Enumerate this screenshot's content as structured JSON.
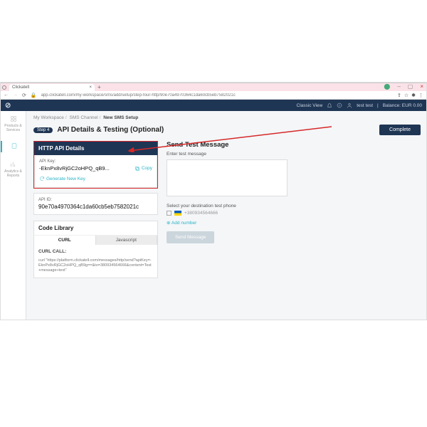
{
  "browser": {
    "tab_title": "Clickatell",
    "url": "app.clickatell.com/my-workspace/sms/add/setup/step-four-http/90e70a4970364c1da60cb5eb7582021c",
    "win_min": "–",
    "win_max": "▢",
    "win_close": "×",
    "tab_close": "×",
    "new_tab": "+"
  },
  "topnav": {
    "logo": "⊘",
    "classic_view": "Classic View",
    "user": "test test",
    "balance": "Balance: EUR 0.00"
  },
  "rail": {
    "item0": "Products & Services",
    "item1": "",
    "item2": "Analytics & Reports"
  },
  "crumb": {
    "c0": "My Workspace",
    "c1": "SMS Channel",
    "c2": "New SMS Setup"
  },
  "step": {
    "pill": "Step 4",
    "title": "API Details & Testing (Optional)",
    "complete": "Complete"
  },
  "http_panel": {
    "title": "HTTP API Details",
    "api_key_label": "API Key:",
    "api_key": "-EknPx8vRjGC2oHPQ_qB9...",
    "copy": "Copy",
    "generate": "Generate New Key",
    "api_id_label": "API ID:",
    "api_id": "90e70a4970364c1da60cb5eb7582021c"
  },
  "codelib": {
    "title": "Code Library",
    "tab_curl": "CURL",
    "tab_js": "Javascript",
    "head": "CURL CALL:",
    "sub": "",
    "body": "curl\n\"https://platform.clickatell.com/messages/http/send?apiKey=-EknPx8vRjGC2oHPQ_qB9g==&to=380934564666&content=Test+message+text\""
  },
  "test": {
    "head": "Send Test Message",
    "msg_label": "Enter test message",
    "dest_label": "Select your destination test phone",
    "phone_mask": "+380934564666",
    "add_number": "Add number",
    "send": "Send Message"
  }
}
